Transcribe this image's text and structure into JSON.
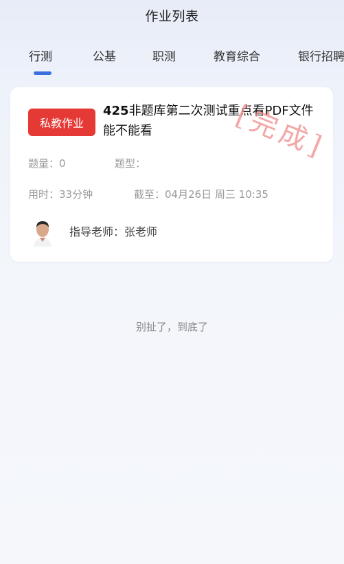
{
  "header": {
    "title": "作业列表"
  },
  "tabs": [
    {
      "label": "行测",
      "active": true
    },
    {
      "label": "公基",
      "active": false
    },
    {
      "label": "职测",
      "active": false
    },
    {
      "label": "教育综合",
      "active": false
    },
    {
      "label": "银行招聘",
      "active": false
    }
  ],
  "accent_color": "#3b6fe0",
  "card": {
    "badge": "私教作业",
    "badge_color": "#e53935",
    "title_number": "425",
    "title_text": "非题库第二次测试重点看PDF文件能不能看",
    "stamp": "[完成]",
    "question_count": "题量：0",
    "question_type": "题型：",
    "time_used": "用时：33分钟",
    "deadline": "截至：04月26日 周三 10:35",
    "teacher": "指导老师：张老师",
    "avatar_icon": "person-avatar"
  },
  "footer": {
    "end_text": "别扯了，到底了"
  }
}
